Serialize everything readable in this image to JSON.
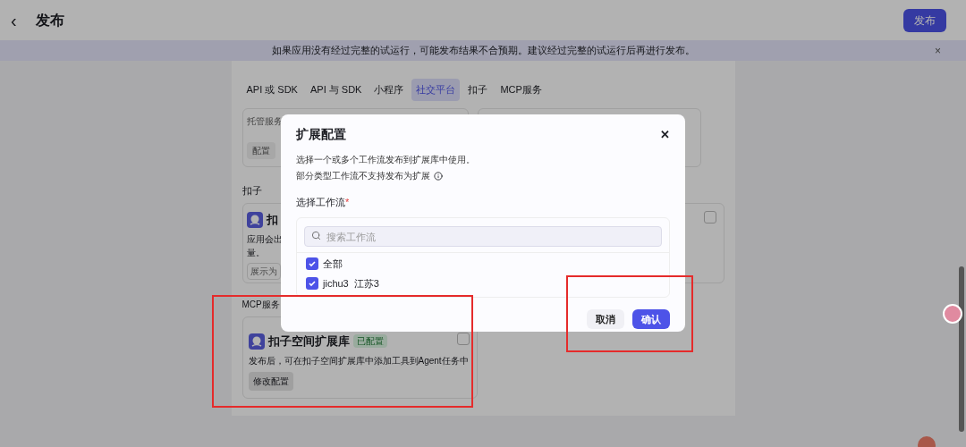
{
  "header": {
    "back": "‹",
    "title": "发布",
    "publish_button": "发布"
  },
  "banner": {
    "text": "如果应用没有经过完整的试运行，可能发布结果不合预期。建议经过完整的试运行后再进行发布。",
    "close": "×"
  },
  "tabs": [
    {
      "label": "API 或 SDK",
      "selected": false
    },
    {
      "label": "API 与 SDK",
      "selected": false
    },
    {
      "label": "小程序",
      "selected": false
    },
    {
      "label": "社交平台",
      "selected": true
    },
    {
      "label": "扣子",
      "selected": false
    },
    {
      "label": "MCP服务",
      "selected": false
    }
  ],
  "top_card": {
    "description": "托管服务",
    "button": "配置"
  },
  "sections": [
    {
      "title": "扣子",
      "card": {
        "title": "扣",
        "description": "应用会出",
        "description_2": "量。",
        "select": "展示为",
        "checked": false
      }
    },
    {
      "title": "MCP服务",
      "card": {
        "title": "扣子空间扩展库",
        "badge": "已配置",
        "description": "发布后，可在扣子空间扩展库中添加工具到Agent任务中",
        "button": "修改配置",
        "checked": false
      }
    }
  ],
  "dialog": {
    "title": "扩展配置",
    "close": "✕",
    "description": "选择一个或多个工作流发布到扩展库中使用。",
    "note": "部分类型工作流不支持发布为扩展",
    "field_label": "选择工作流",
    "required": "*",
    "search": {
      "placeholder": "搜索工作流"
    },
    "options": [
      {
        "label": "全部",
        "checked": true
      },
      {
        "label": "jichu3  江苏3",
        "checked": true
      }
    ],
    "buttons": [
      {
        "label": "取消",
        "kind": "secondary"
      },
      {
        "label": "确认",
        "kind": "primary"
      }
    ]
  }
}
